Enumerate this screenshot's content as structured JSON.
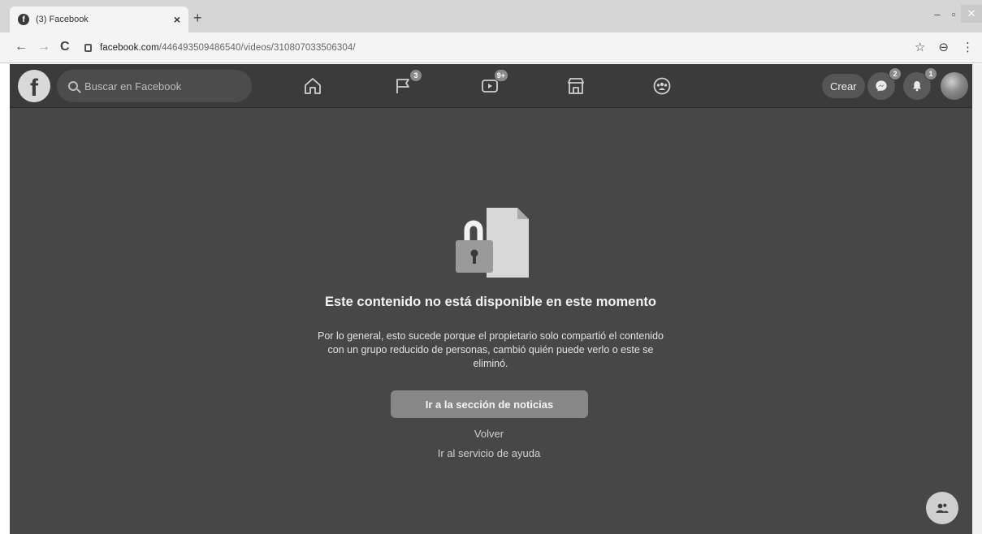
{
  "browser": {
    "tab": {
      "title": "(3) Facebook",
      "favicon": "facebook-favicon",
      "close": "×"
    },
    "new_tab": "+",
    "window_controls": [
      "–",
      "▫",
      "✕"
    ],
    "nav": {
      "back": "←",
      "forward": "→",
      "reload": "C"
    },
    "url": {
      "host": "facebook.com",
      "path": "/446493509486540/videos/310807033506304/"
    },
    "icons": [
      "star-icon",
      "account-icon",
      "menu-icon"
    ],
    "icon_glyphs": {
      "star": "☆",
      "account": "⊖",
      "menu": "⋮"
    }
  },
  "fbnav": {
    "logo": "f",
    "search_placeholder": "Buscar en Facebook",
    "items": [
      {
        "name": "home",
        "badge": ""
      },
      {
        "name": "pages",
        "badge": "3"
      },
      {
        "name": "watch",
        "badge": "9+"
      },
      {
        "name": "marketplace",
        "badge": ""
      },
      {
        "name": "groups",
        "badge": ""
      }
    ],
    "crear_label": "Crear",
    "messenger_badge": "2",
    "notifications_badge": "1"
  },
  "content": {
    "title": "Este contenido no está disponible en este momento",
    "body": "Por lo general, esto sucede porque el propietario solo compartió el contenido con un grupo reducido de personas, cambió quién puede verlo o este se eliminó.",
    "primary_button": "Ir a la sección de noticias",
    "back_link": "Volver",
    "help_link": "Ir al servicio de ayuda"
  },
  "colors": {
    "nav_bg": "#3b3b3b",
    "content_bg": "#474747",
    "button_bg": "#878787"
  }
}
